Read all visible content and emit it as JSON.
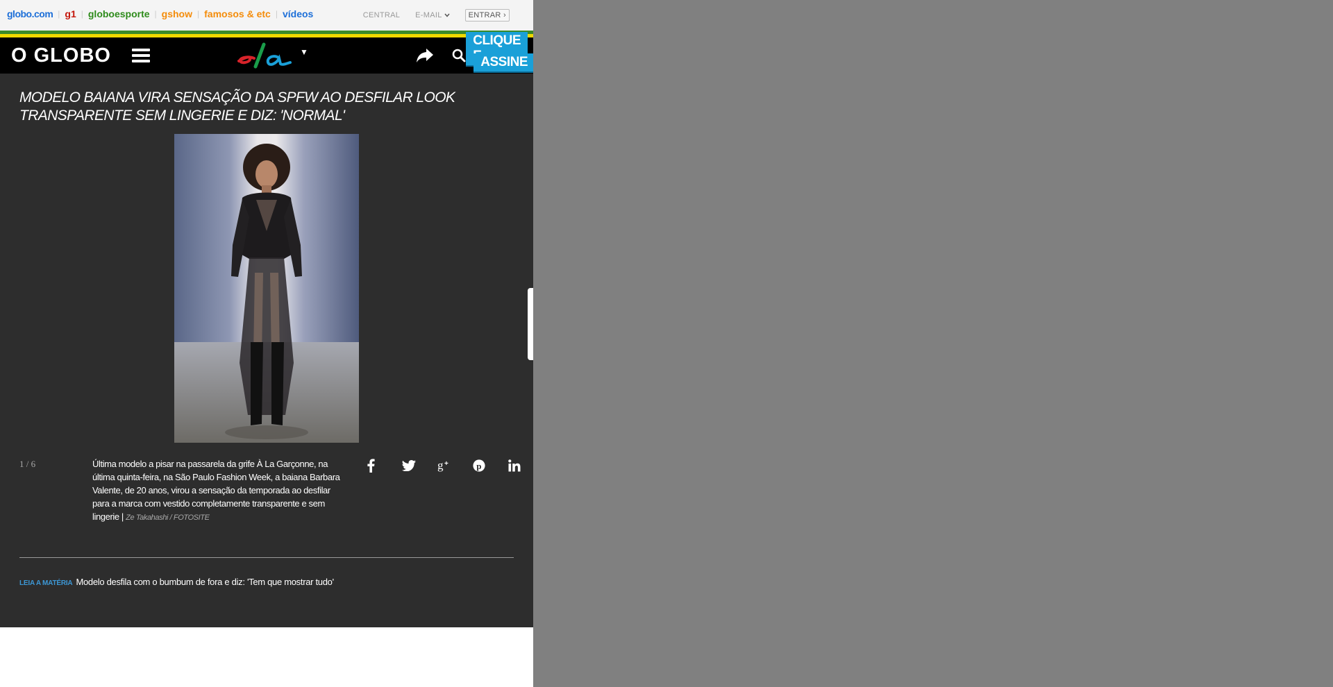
{
  "topbar": {
    "sites": [
      {
        "label": "globo.com",
        "color": "#1d6fd8"
      },
      {
        "label": "g1",
        "color": "#c4170c"
      },
      {
        "label": "globoesporte",
        "color": "#2e8b1b"
      },
      {
        "label": "gshow",
        "color": "#f48c0a"
      },
      {
        "label": "famosos & etc",
        "color": "#f48c0a"
      },
      {
        "label": "vídeos",
        "color": "#1d6fd8"
      }
    ],
    "central_label": "CENTRAL",
    "email_label": "E-MAIL",
    "login_label": "ENTRAR ›"
  },
  "header": {
    "logo": "O GLOBO",
    "section_logo": "ela",
    "subscribe_line1": "CLIQUE E",
    "subscribe_line2": "ASSINE",
    "accent_color": "#1aa0d8"
  },
  "gallery": {
    "title": "MODELO BAIANA VIRA SENSAÇÃO DA SPFW AO DESFILAR LOOK TRANSPARENTE SEM LINGERIE E DIZ: 'NORMAL'",
    "counter": "1 / 6",
    "caption": "Última modelo a pisar na passarela da grife À La Garçonne, na última quinta-feira, na São Paulo Fashion Week, a baiana Barbara Valente, de 20 anos, virou a sensação da temporada ao desfilar para a marca com vestido completamente transparente e sem lingerie |",
    "credit": "Ze Takahashi / FOTOSITE",
    "share_icons": [
      "facebook-icon",
      "twitter-icon",
      "google-plus-icon",
      "pinterest-icon",
      "linkedin-icon"
    ],
    "read_more_label": "LEIA A MATÉRIA",
    "read_more_text": "Modelo desfila com o bumbum de fora e diz: 'Tem que mostrar tudo'"
  }
}
